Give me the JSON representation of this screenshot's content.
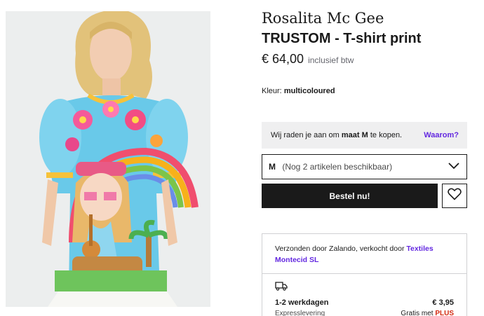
{
  "product": {
    "brand": "Rosalita Mc Gee",
    "title": "TRUSTOM - T-shirt print",
    "price": "€ 64,00",
    "vat_note": "inclusief btw",
    "image_alt": "product-photo"
  },
  "color": {
    "label": "Kleur:",
    "value": "multicoloured"
  },
  "size_advice": {
    "text_before": "Wij raden je aan om",
    "recommended": "maat M",
    "text_after": "te kopen.",
    "link": "Waarom?"
  },
  "size_select": {
    "size": "M",
    "availability": "(Nog 2 artikelen beschikbaar)",
    "icon": "chevron-down-icon"
  },
  "actions": {
    "order_label": "Bestel nu!",
    "wishlist_icon": "heart-icon"
  },
  "seller": {
    "prefix": "Verzonden door Zalando, verkocht door",
    "seller_name": "Textiles Montecid SL"
  },
  "shipping": {
    "icon": "truck-icon",
    "standard_label": "1-2 werkdagen",
    "standard_price": "€ 3,95",
    "express_label": "Expresslevering",
    "express_partial": "Gratis met",
    "express_plus": "PLUS"
  },
  "colors": {
    "accent": "#6328e0",
    "button_bg": "#1a1a1a",
    "advice_bg": "#efeff0",
    "plus_red": "#d42a12"
  }
}
